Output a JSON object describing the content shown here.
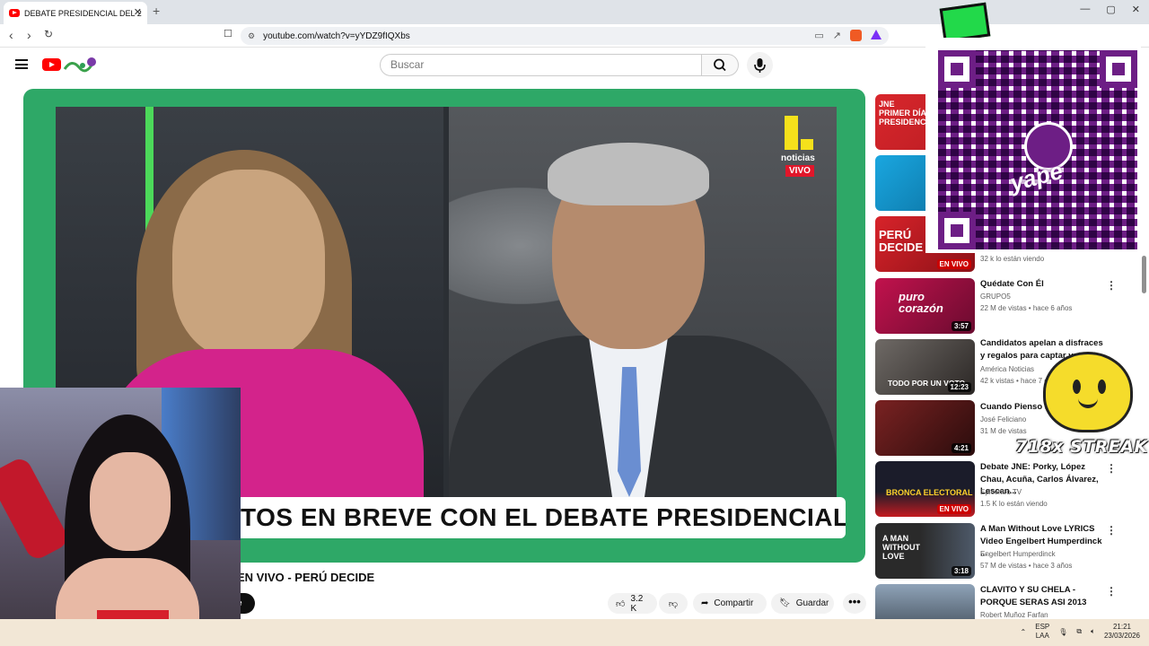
{
  "browser": {
    "tab_title": "DEBATE PRESIDENCIAL DEL 2",
    "tab_close": "✕",
    "new_tab": "+",
    "url": "youtube.com/watch?v=yYDZ9fIQXbs",
    "window_controls": [
      "—",
      "▢",
      "✕"
    ]
  },
  "youtube": {
    "search_placeholder": "Buscar",
    "video": {
      "channel_logo_text": "noticias",
      "live_tag": "VIVO",
      "lower_third": "TOS EN BREVE CON EL DEBATE PRESIDENCIAL",
      "title_partial": "EN VIVO - PERÚ DECIDE",
      "channel_pill": "e",
      "likes": "3.2 K",
      "share": "Compartir",
      "save": "Guardar",
      "more": "•••"
    },
    "sidebar": [
      {
        "thumb_text": "JNE\nPRIMER DÍA DE\nPRESIDENCIA",
        "colors": [
          "#d9262c",
          "#b81d22"
        ]
      },
      {
        "colors": [
          "#1aa7e0",
          "#0a6d9c"
        ]
      },
      {
        "thumb_text": "PERÚ\nDECIDE",
        "live": "EN VIVO",
        "meta": "32 k lo están viendo",
        "colors": [
          "#d8232a",
          "#8c1117"
        ]
      },
      {
        "title": "Quédate Con Él",
        "channel": "GRUPO5",
        "meta": "22 M de vistas • hace 6 años",
        "duration": "3:57",
        "thumb_text": "puro\ncorazón",
        "colors": [
          "#c2124d",
          "#6a0b2f"
        ]
      },
      {
        "title": "Candidatos apelan a disfraces y regalos para captar votos |",
        "channel": "América Noticias",
        "meta": "42 k vistas • hace 7 d",
        "duration": "12:23",
        "thumb_text": "TODO POR UN VOTO",
        "colors": [
          "#6f6a66",
          "#2b2725"
        ]
      },
      {
        "title": "Cuando Pienso E",
        "channel": "José Feliciano",
        "meta": "31 M de vistas",
        "duration": "4:21",
        "colors": [
          "#7a2222",
          "#2a0c0c"
        ]
      },
      {
        "title": "Debate JNE: Porky, López Chau, Acuña, Carlos Álvarez, Lescan...",
        "channel": "Epicentro TV",
        "meta": "1.5 K lo están viendo",
        "live": "EN VIVO",
        "thumb_text": "BRONCA ELECTORAL",
        "colors": [
          "#1b1c2a",
          "#c41b20"
        ]
      },
      {
        "title": "A Man Without Love LYRICS Video Engelbert Humperdinck ...",
        "channel": "Engelbert Humperdinck",
        "meta": "57 M de vistas • hace 3 años",
        "duration": "3:18",
        "thumb_text": "A MAN\nWITHOUT\nLOVE",
        "colors": [
          "#2a2a2a",
          "#4e5a6a"
        ]
      },
      {
        "title": "CLAVITO Y SU CHELA - PORQUE SERAS ASI 2013",
        "channel": "Robert Muñoz Farfan",
        "colors": [
          "#8fa3b8",
          "#3a4550"
        ]
      }
    ]
  },
  "overlay": {
    "qr_brand": "yape",
    "streak": "718x STREAK"
  },
  "taskbar": {
    "lang_top": "ESP",
    "lang_bottom": "LAA",
    "time": "21:21",
    "date": "23/03/2026"
  }
}
